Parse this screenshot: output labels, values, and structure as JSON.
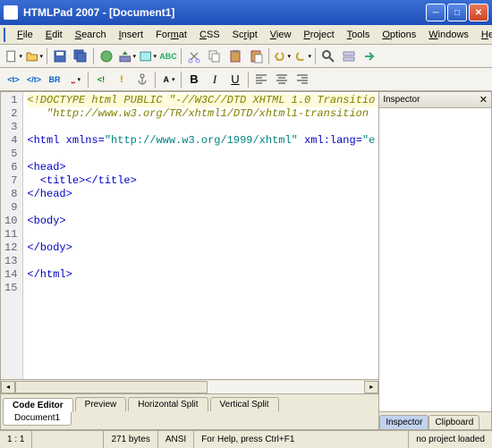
{
  "titlebar": {
    "text": "HTMLPad 2007 - [Document1]"
  },
  "menubar": {
    "items": [
      {
        "label": "File",
        "u": "F"
      },
      {
        "label": "Edit",
        "u": "E"
      },
      {
        "label": "Search",
        "u": "S"
      },
      {
        "label": "Insert",
        "u": "I"
      },
      {
        "label": "Format",
        "u": "m"
      },
      {
        "label": "CSS",
        "u": "C"
      },
      {
        "label": "Script",
        "u": "r"
      },
      {
        "label": "View",
        "u": "V"
      },
      {
        "label": "Project",
        "u": "P"
      },
      {
        "label": "Tools",
        "u": "T"
      },
      {
        "label": "Options",
        "u": "O"
      },
      {
        "label": "Windows",
        "u": "W"
      },
      {
        "label": "Help",
        "u": "H"
      }
    ]
  },
  "editor": {
    "lines": [
      {
        "n": 1,
        "html": "<span class='line1'><span class='c-doc'>&lt;!DOCTYPE html PUBLIC \"-//W3C//DTD XHTML 1.0 Transitio</span></span>"
      },
      {
        "n": 2,
        "html": "   <span class='c-doc'>\"http://www.w3.org/TR/xhtml1/DTD/xhtml1-transition</span>"
      },
      {
        "n": 3,
        "html": ""
      },
      {
        "n": 4,
        "html": "<span class='c-tag'>&lt;html</span> <span class='c-attr'>xmlns=</span><span class='c-str'>\"http://www.w3.org/1999/xhtml\"</span> <span class='c-attr'>xml:lang=</span><span class='c-str'>\"e</span>"
      },
      {
        "n": 5,
        "html": ""
      },
      {
        "n": 6,
        "html": "<span class='c-tag'>&lt;head&gt;</span>"
      },
      {
        "n": 7,
        "html": "  <span class='c-tag'>&lt;title&gt;&lt;/title&gt;</span>"
      },
      {
        "n": 8,
        "html": "<span class='c-tag'>&lt;/head&gt;</span>"
      },
      {
        "n": 9,
        "html": ""
      },
      {
        "n": 10,
        "html": "<span class='c-tag'>&lt;body&gt;</span>"
      },
      {
        "n": 11,
        "html": ""
      },
      {
        "n": 12,
        "html": "<span class='c-tag'>&lt;/body&gt;</span>"
      },
      {
        "n": 13,
        "html": ""
      },
      {
        "n": 14,
        "html": "<span class='c-tag'>&lt;/html&gt;</span>"
      },
      {
        "n": 15,
        "html": ""
      }
    ],
    "view_tabs": [
      "Code Editor",
      "Preview",
      "Horizontal Split",
      "Vertical Split"
    ],
    "doc_tabs": [
      "Document1"
    ]
  },
  "inspector": {
    "title": "Inspector",
    "tabs": [
      "Inspector",
      "Clipboard"
    ]
  },
  "status": {
    "pos": "1 : 1",
    "size": "271 bytes",
    "enc": "ANSI",
    "help": "For Help, press Ctrl+F1",
    "proj": "no project loaded"
  }
}
